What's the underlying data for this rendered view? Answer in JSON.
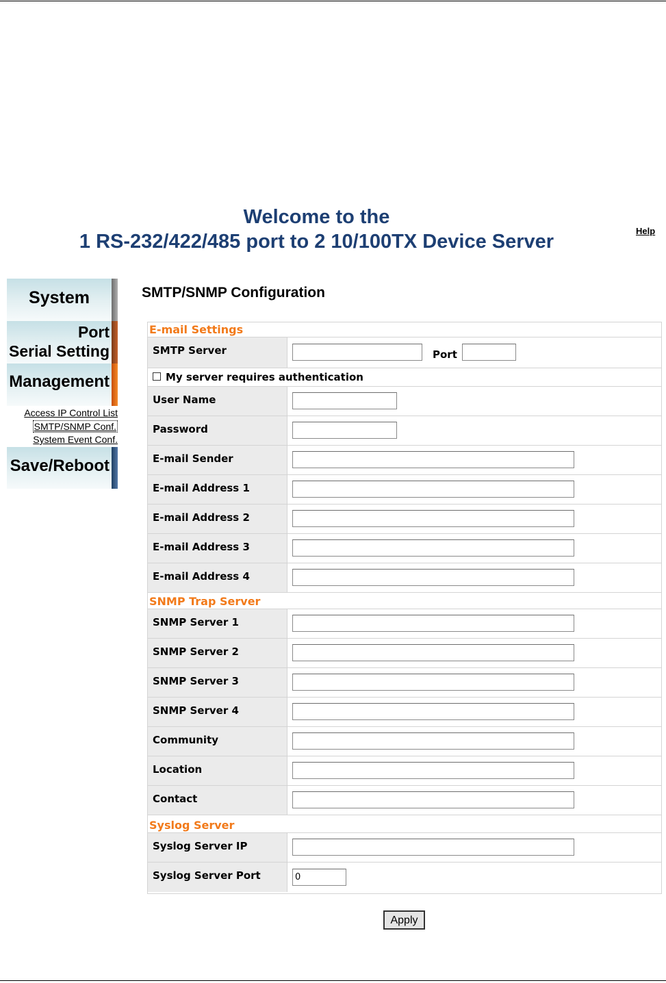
{
  "header": {
    "welcome_line1": "Welcome to the",
    "welcome_line2": "1 RS-232/422/485 port to 2 10/100TX Device Server",
    "help_link": "Help"
  },
  "sidebar": {
    "system": "System",
    "port_line1": "Port",
    "port_line2": "Serial Setting",
    "management": "Management",
    "sub_items": [
      "Access IP Control List",
      "SMTP/SNMP Conf.",
      "System Event Conf."
    ],
    "save_reboot": "Save/Reboot"
  },
  "page_title": "SMTP/SNMP Configuration",
  "email": {
    "heading": "E-mail Settings",
    "smtp_server_label": "SMTP Server",
    "smtp_server_value": "",
    "port_label": "Port",
    "port_value": "",
    "auth_label": "My server requires authentication",
    "user_name_label": "User Name",
    "password_label": "Password",
    "sender_label": "E-mail Sender",
    "address1_label": "E-mail Address 1",
    "address2_label": "E-mail Address 2",
    "address3_label": "E-mail Address 3",
    "address4_label": "E-mail Address 4"
  },
  "snmp": {
    "heading": "SNMP Trap Server",
    "server1_label": "SNMP Server 1",
    "server2_label": "SNMP Server 2",
    "server3_label": "SNMP Server 3",
    "server4_label": "SNMP Server 4",
    "community_label": "Community",
    "location_label": "Location",
    "contact_label": "Contact"
  },
  "syslog": {
    "heading": "Syslog Server",
    "ip_label": "Syslog Server IP",
    "port_label": "Syslog Server Port",
    "port_value": "0"
  },
  "apply_label": "Apply",
  "colors": {
    "title_blue": "#1d3f73",
    "section_orange": "#f27a1a",
    "label_bg": "#ebebeb"
  }
}
